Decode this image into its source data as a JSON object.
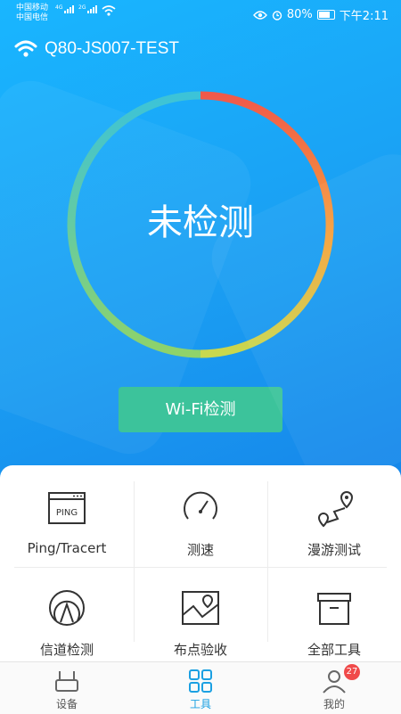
{
  "status_bar": {
    "carrier1": "中国移动",
    "carrier2": "中国电信",
    "net1": "4G",
    "net2": "2G",
    "battery": "80%",
    "time": "下午2:11"
  },
  "header": {
    "ssid": "Q80-JS007-TEST"
  },
  "gauge": {
    "status_text": "未检测",
    "colors": [
      "#3cc3d8",
      "#8fd36a",
      "#f6a23c",
      "#f0594a"
    ]
  },
  "actions": {
    "wifi_check_label": "Wi-Fi检测",
    "button_color": "#3cc39b"
  },
  "tools": [
    {
      "label": "Ping/Tracert",
      "icon": "ping-icon",
      "icon_text": "PING"
    },
    {
      "label": "测速",
      "icon": "speedometer-icon"
    },
    {
      "label": "漫游测试",
      "icon": "roaming-route-icon"
    },
    {
      "label": "信道检测",
      "icon": "channel-signal-icon"
    },
    {
      "label": "布点验收",
      "icon": "map-pin-icon"
    },
    {
      "label": "全部工具",
      "icon": "toolbox-icon"
    }
  ],
  "bottom_nav": {
    "items": [
      {
        "label": "设备",
        "icon": "router-icon"
      },
      {
        "label": "工具",
        "icon": "grid-icon",
        "active": true
      },
      {
        "label": "我的",
        "icon": "user-icon"
      }
    ],
    "badge_count": "27",
    "active_color": "#1ba0e2"
  }
}
